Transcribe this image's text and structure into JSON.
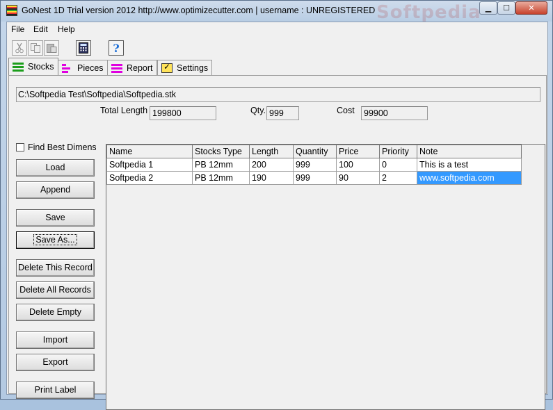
{
  "window": {
    "title": "GoNest 1D Trial version  2012  http://www.optimizecutter.com | username : UNREGISTERED",
    "watermark": "Softpedia",
    "min_glyph": "▁",
    "max_glyph": "☐",
    "close_glyph": "✕"
  },
  "menu": [
    "File",
    "Edit",
    "Help"
  ],
  "toolbar": {
    "buttons": [
      "cut-icon",
      "copy-icon",
      "paste-icon",
      "calculator-icon",
      "help-icon"
    ],
    "help_glyph": "?"
  },
  "tabs": [
    {
      "label": "Stocks",
      "icon": "stocks-icon",
      "active": true
    },
    {
      "label": "Pieces",
      "icon": "pieces-icon",
      "active": false
    },
    {
      "label": "Report",
      "icon": "report-icon",
      "active": false
    },
    {
      "label": "Settings",
      "icon": "settings-icon",
      "active": false
    }
  ],
  "stocks": {
    "file_path": "C:\\Softpedia Test\\Softpedia\\Softpedia.stk",
    "total_length_label": "Total Length",
    "total_length_value": "199800",
    "qty_label": "Qty.",
    "qty_value": "999",
    "cost_label": "Cost",
    "cost_value": "99900",
    "find_best_label": "Find Best Dimensions",
    "buttons": {
      "load": "Load",
      "append": "Append",
      "save": "Save",
      "save_as": "Save As...",
      "delete_record": "Delete This Record",
      "delete_all": "Delete All Records",
      "delete_empty": "Delete Empty",
      "import": "Import",
      "export": "Export",
      "print_label": "Print Label"
    }
  },
  "table": {
    "columns": [
      "Name",
      "Stocks Type",
      "Length",
      "Quantity",
      "Price",
      "Priority",
      "Note"
    ],
    "rows": [
      [
        "Softpedia 1",
        "PB  12mm",
        "200",
        "999",
        "100",
        "0",
        "This is a test"
      ],
      [
        "Softpedia 2",
        "PB  12mm",
        "190",
        "999",
        "90",
        "2",
        "www.softpedia.com"
      ]
    ],
    "selected_cell": {
      "row": 1,
      "col": 6
    }
  }
}
